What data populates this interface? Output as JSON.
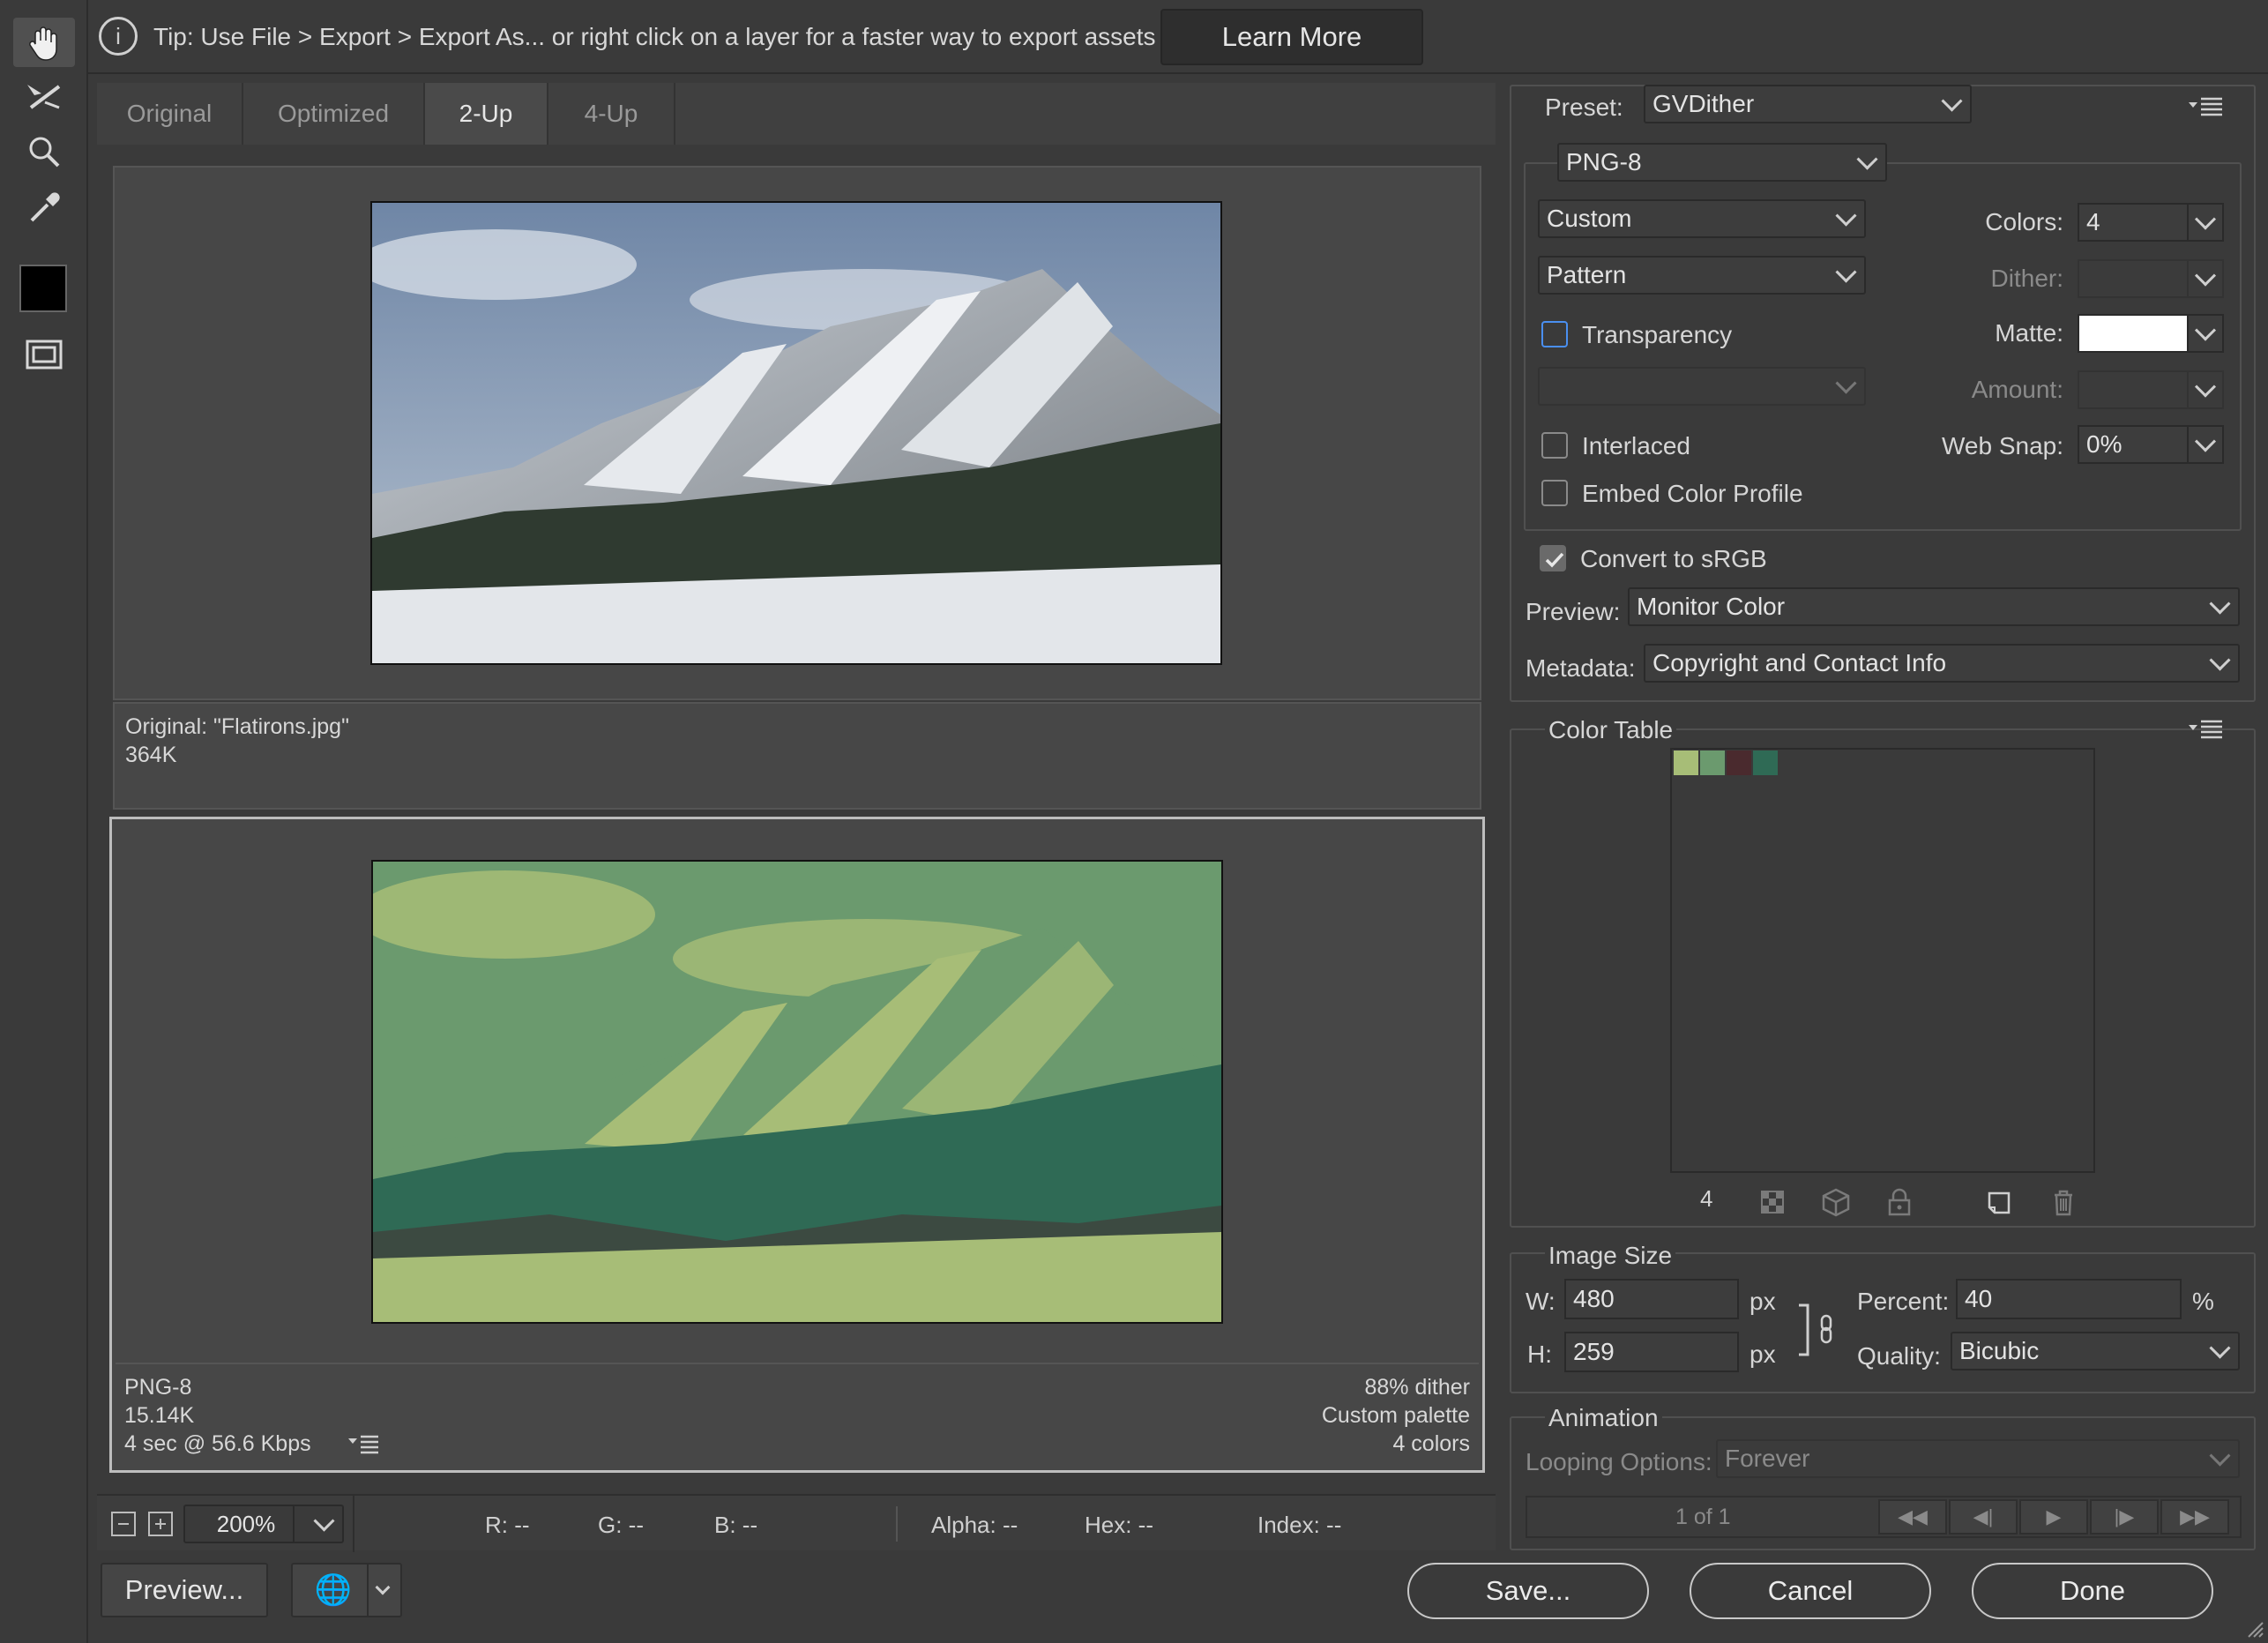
{
  "tip": {
    "text": "Tip: Use File > Export > Export As...  or right click on a layer for a faster way to export assets",
    "button": "Learn More"
  },
  "tools": [
    "hand-tool",
    "slice-select-tool",
    "zoom-tool",
    "eyedropper-tool",
    "eyedropper-color",
    "toggle-slices-visibility"
  ],
  "tabs": [
    {
      "label": "Original",
      "active": false
    },
    {
      "label": "Optimized",
      "active": false
    },
    {
      "label": "2-Up",
      "active": true
    },
    {
      "label": "4-Up",
      "active": false
    }
  ],
  "original_pane": {
    "line1": "Original: \"Flatirons.jpg\"",
    "line2": "364K"
  },
  "optimized_pane": {
    "left": [
      "PNG-8",
      "15.14K",
      "4 sec @ 56.6 Kbps"
    ],
    "right": [
      "88% dither",
      "Custom palette",
      "4 colors"
    ]
  },
  "status": {
    "zoom": "200%",
    "r": "R: --",
    "g": "G: --",
    "b": "B: --",
    "alpha": "Alpha: --",
    "hex": "Hex: --",
    "index": "Index: --"
  },
  "settings": {
    "preset_label": "Preset:",
    "preset_value": "GVDither",
    "format": "PNG-8",
    "palette": "Custom",
    "dither_algo": "Pattern",
    "colors_label": "Colors:",
    "colors_value": "4",
    "dither_label": "Dither:",
    "dither_value": "",
    "transparency_label": "Transparency",
    "transparency_checked": false,
    "matte_label": "Matte:",
    "transparency_dither": "",
    "amount_label": "Amount:",
    "amount_value": "",
    "interlaced_label": "Interlaced",
    "interlaced_checked": false,
    "websnap_label": "Web Snap:",
    "websnap_value": "0%",
    "embed_label": "Embed Color Profile",
    "embed_checked": false,
    "srgb_label": "Convert to sRGB",
    "srgb_checked": true,
    "preview_label": "Preview:",
    "preview_value": "Monitor Color",
    "metadata_label": "Metadata:",
    "metadata_value": "Copyright and Contact Info"
  },
  "color_table": {
    "title": "Color Table",
    "count": "4",
    "swatches": [
      "#a7bd77",
      "#6b9a6e",
      "#4a2a2e",
      "#2f6a55"
    ]
  },
  "image_size": {
    "title": "Image Size",
    "w_label": "W:",
    "w_value": "480",
    "h_label": "H:",
    "h_value": "259",
    "unit": "px",
    "percent_label": "Percent:",
    "percent_value": "40",
    "percent_unit": "%",
    "quality_label": "Quality:",
    "quality_value": "Bicubic"
  },
  "animation": {
    "title": "Animation",
    "looping_label": "Looping Options:",
    "looping_value": "Forever",
    "frame": "1 of 1"
  },
  "buttons": {
    "preview": "Preview...",
    "save": "Save...",
    "cancel": "Cancel",
    "done": "Done"
  },
  "colors": {
    "matte": "#ffffff",
    "foreground": "#000000",
    "accent_checkbox": "#4a8ff0"
  }
}
